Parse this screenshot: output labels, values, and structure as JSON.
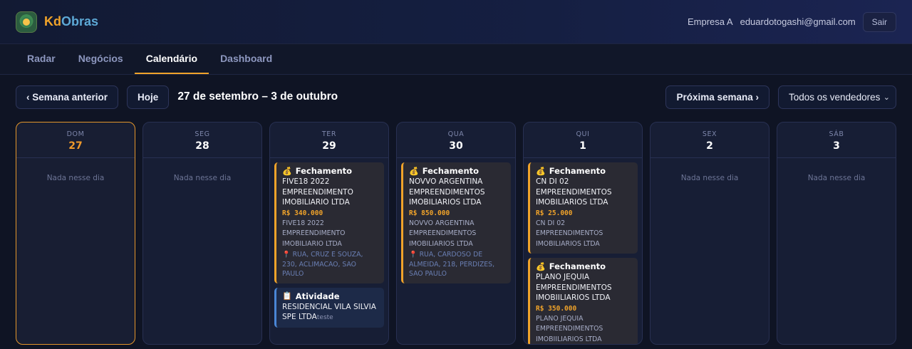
{
  "app": {
    "brand_part1": "Kd",
    "brand_part2": "Obras"
  },
  "header": {
    "company": "Empresa A",
    "email": "eduardotogashi@gmail.com",
    "logout_label": "Sair"
  },
  "nav": {
    "tabs": [
      {
        "label": "Radar"
      },
      {
        "label": "Negócios"
      },
      {
        "label": "Calendário",
        "active": true
      },
      {
        "label": "Dashboard"
      }
    ]
  },
  "toolbar": {
    "prev_week_label": "‹ Semana anterior",
    "today_label": "Hoje",
    "week_range": "27 de setembro – 3 de outubro",
    "next_week_label": "Próxima semana ›",
    "seller_filter": "Todos os vendedores"
  },
  "calendar": {
    "empty_label": "Nada nesse dia",
    "days": [
      {
        "name": "DOM",
        "num": "27"
      },
      {
        "name": "SEG",
        "num": "28"
      },
      {
        "name": "TER",
        "num": "29"
      },
      {
        "name": "QUA",
        "num": "30"
      },
      {
        "name": "QUI",
        "num": "1"
      },
      {
        "name": "SEX",
        "num": "2"
      },
      {
        "name": "SÁB",
        "num": "3"
      }
    ],
    "events": {
      "ter_1": {
        "type": "Fechamento",
        "icon": "💰",
        "name": "FIVE18 2022 EMPREENDIMENTO IMOBILIARIO LTDA",
        "value": "R$ 340.000",
        "company": "FIVE18 2022 EMPREENDIMENTO IMOBILIARIO LTDA",
        "address": "RUA, CRUZ E SOUZA, 230, ACLIMACAO, SAO PAULO"
      },
      "ter_2": {
        "type": "Atividade",
        "icon": "📋",
        "name": "RESIDENCIAL VILA SILVIA SPE LTDA",
        "note": "teste"
      },
      "qua_1": {
        "type": "Fechamento",
        "icon": "💰",
        "name": "NOVVO ARGENTINA EMPREENDIMENTOS IMOBILIARIOS LTDA",
        "value": "R$ 850.000",
        "company": "NOVVO ARGENTINA EMPREENDIMENTOS IMOBILIARIOS LTDA",
        "address": "RUA, CARDOSO DE ALMEIDA, 218, PERDIZES, SAO PAULO"
      },
      "qui_1": {
        "type": "Fechamento",
        "icon": "💰",
        "name": "CN DI 02 EMPREENDIMENTOS IMOBILIARIOS LTDA",
        "value": "R$ 25.000",
        "company": "CN DI 02 EMPREENDIMENTOS IMOBILIARIOS LTDA"
      },
      "qui_2": {
        "type": "Fechamento",
        "icon": "💰",
        "name": "PLANO JEQUIA EMPREENDIMENTOS IMOBIILIARIOS LTDA",
        "value": "R$ 350.000",
        "company": "PLANO JEQUIA EMPREENDIMENTOS IMOBIILIARIOS LTDA"
      }
    },
    "address_pin_icon": "📍"
  },
  "colors": {
    "accent": "#f0a32a",
    "background": "#0f1424",
    "activity": "#4a86d6"
  }
}
